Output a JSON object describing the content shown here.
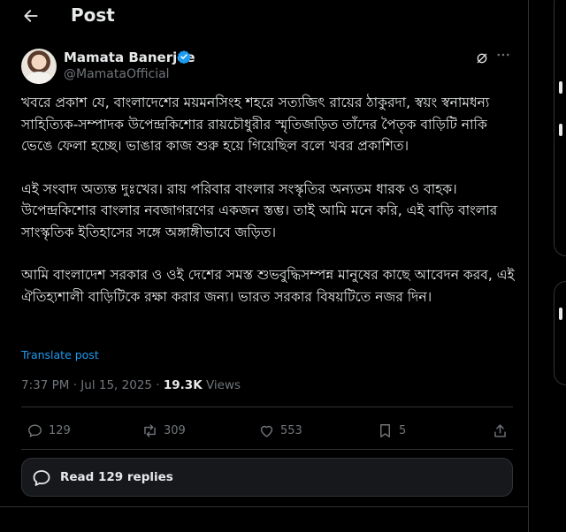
{
  "header": {
    "title": "Post"
  },
  "author": {
    "name": "Mamata Banerjee",
    "handle": "@MamataOfficial"
  },
  "post": {
    "paragraphs": [
      "খবরে প্রকাশ যে, বাংলাদেশের ময়মনসিংহ শহরে সত্যজিৎ রায়ের ঠাকুরদা, স্বয়ং স্বনামধন্য সাহিত্যিক-সম্পাদক উপেন্দ্রকিশোর রায়চৌধুরীর স্মৃতিজড়িত তাঁদের পৈতৃক বাড়িটি নাকি ভেঙে ফেলা হচ্ছে। ভাঙার কাজ শুরু হয়ে গিয়েছিল বলে খবর প্রকাশিত।",
      "এই সংবাদ অত্যন্ত দুঃখের। রায় পরিবার বাংলার সংস্কৃতির অন্যতম ধারক ও বাহক। উপেন্দ্রকিশোর বাংলার নবজাগরণের একজন স্তম্ভ। তাই আমি মনে করি, এই বাড়ি বাংলার সাংস্কৃতিক ইতিহাসের সঙ্গে অঙ্গাঙ্গীভাবে জড়িত।",
      "আমি বাংলাদেশ সরকার ও ওই দেশের সমস্ত শুভবুদ্ধিসম্পন্ন মানুষের কাছে আবেদন করব, এই ঐতিহ্যশালী বাড়িটিকে রক্ষা করার জন্য। ভারত সরকার বিষয়টিতে নজর দিন।"
    ],
    "translate_label": "Translate post",
    "time": "7:37 PM",
    "date": "Jul 15, 2025",
    "views_count": "19.3K",
    "views_label": "Views",
    "separator": "·"
  },
  "actions": {
    "replies": "129",
    "reposts": "309",
    "likes": "553",
    "bookmarks": "5"
  },
  "replies_button": {
    "label": "Read 129 replies"
  },
  "colors": {
    "background": "#000000",
    "text": "#e7e9ea",
    "muted": "#71767b",
    "accent": "#1d9bf0",
    "border": "#2f3336"
  }
}
